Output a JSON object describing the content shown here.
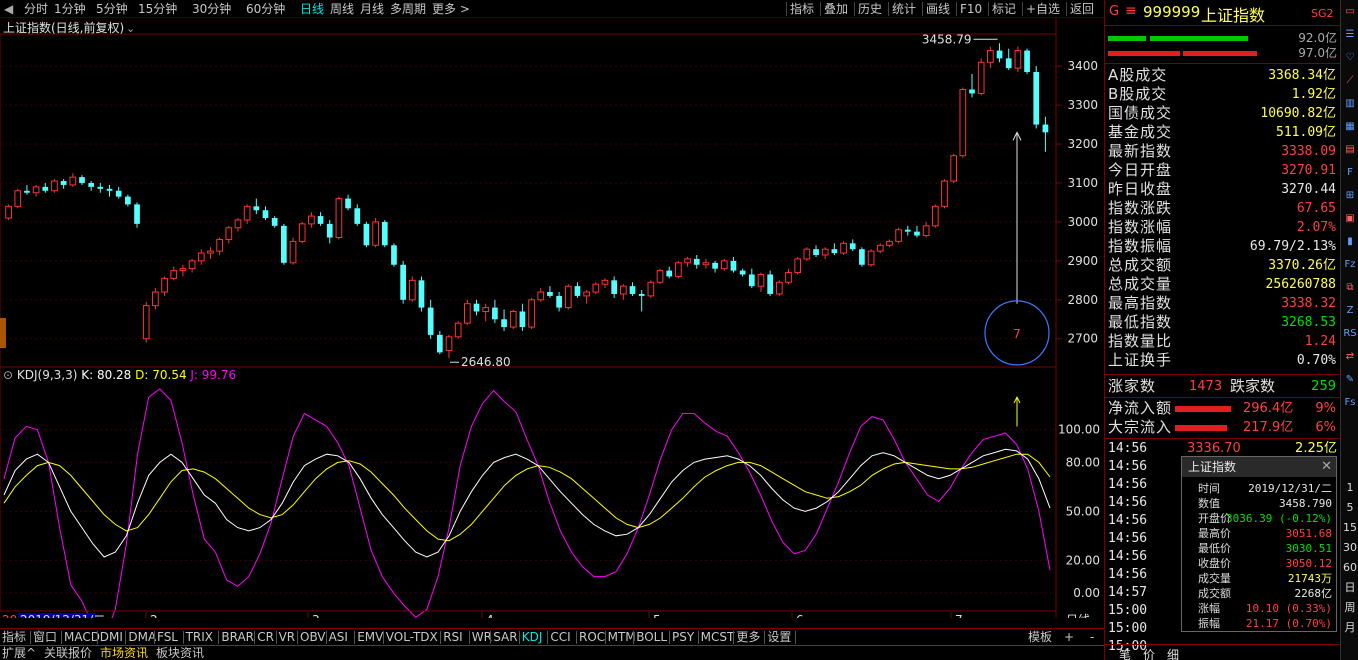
{
  "toolbar": {
    "periods": [
      "分时",
      "1分钟",
      "5分钟",
      "15分钟",
      "30分钟",
      "60分钟",
      "日线",
      "周线",
      "月线",
      "多周期",
      "更多"
    ],
    "active_period": "日线",
    "right_tools": [
      "指标",
      "叠加",
      "历史",
      "统计",
      "画线",
      "F10",
      "标记",
      "+自选",
      "返回"
    ]
  },
  "chart_title": "上证指数(日线,前复权)",
  "kdj_header": {
    "name": "KDJ(9,3,3)",
    "k": "K: 80.28",
    "d": "D: 70.54",
    "j": "J: 99.76"
  },
  "annotations": {
    "high_label": "3458.79",
    "low_label": "2646.80",
    "circle_label": "7"
  },
  "x_axis": {
    "first": "20",
    "cursor_date": "2019/12/31/二",
    "months": [
      "2",
      "3",
      "4",
      "5",
      "6",
      "7"
    ],
    "period_label": "日线"
  },
  "price_axis": [
    "3400",
    "3300",
    "3200",
    "3100",
    "3000",
    "2900",
    "2800",
    "2700"
  ],
  "kdj_axis": [
    "100.00",
    "80.00",
    "50.00",
    "20.00",
    "0.00"
  ],
  "indicators": [
    "指标",
    "窗口",
    "MACD",
    "DMI",
    "DMA",
    "FSL",
    "TRIX",
    "BRAR",
    "CR",
    "VR",
    "OBV",
    "ASI",
    "EMV",
    "VOL-TDX",
    "RSI",
    "WR",
    "SAR",
    "KDJ",
    "CCI",
    "ROC",
    "MTM",
    "BOLL",
    "PSY",
    "MCST",
    "更多",
    "设置"
  ],
  "active_indicator": "KDJ",
  "indicator_right": [
    "模板",
    "+",
    "-"
  ],
  "bottom_tabs": [
    "扩展^",
    "关联报价",
    "市场资讯",
    "板块资讯"
  ],
  "selected_tab": "市场资讯",
  "panel": {
    "g_letter": "G",
    "code": "999999",
    "name": "上证指数",
    "sg": "SG2",
    "bar1_value": "92.0亿",
    "bar2_value": "97.0亿",
    "rows": [
      {
        "k": "A股成交",
        "v": "3368.34亿",
        "c": "yel"
      },
      {
        "k": "B股成交",
        "v": "1.92亿",
        "c": "yel"
      },
      {
        "k": "国债成交",
        "v": "10690.82亿",
        "c": "yel"
      },
      {
        "k": "基金成交",
        "v": "511.09亿",
        "c": "yel"
      },
      {
        "k": "最新指数",
        "v": "3338.09",
        "c": "red"
      },
      {
        "k": "今日开盘",
        "v": "3270.91",
        "c": "red"
      },
      {
        "k": "昨日收盘",
        "v": "3270.44",
        "c": "wht"
      },
      {
        "k": "指数涨跌",
        "v": "67.65",
        "c": "red"
      },
      {
        "k": "指数涨幅",
        "v": "2.07%",
        "c": "red"
      },
      {
        "k": "指数振幅",
        "v": "69.79/2.13%",
        "c": "wht"
      },
      {
        "k": "总成交额",
        "v": "3370.26亿",
        "c": "yel"
      },
      {
        "k": "总成交量",
        "v": "256260788",
        "c": "yel"
      },
      {
        "k": "最高指数",
        "v": "3338.32",
        "c": "red"
      },
      {
        "k": "最低指数",
        "v": "3268.53",
        "c": "grn"
      },
      {
        "k": "指数量比",
        "v": "1.24",
        "c": "red"
      },
      {
        "k": "上证换手",
        "v": "0.70%",
        "c": "wht"
      }
    ],
    "up_label": "涨家数",
    "up_count": "1473",
    "down_label": "跌家数",
    "down_count": "259",
    "inflow_label": "净流入额",
    "inflow_value": "296.4亿",
    "inflow_pct": "9%",
    "block_label": "大宗流入",
    "block_value": "217.9亿",
    "block_pct": "6%",
    "tick_first": {
      "time": "14:56",
      "price": "3336.70",
      "vol": "2.25亿"
    },
    "ticks": [
      "14:56",
      "14:56",
      "14:56",
      "14:56",
      "14:56",
      "14:56",
      "14:56",
      "14:57",
      "15:00",
      "15:00",
      "15:00"
    ],
    "bottom": [
      "笔",
      "价",
      "细"
    ]
  },
  "popup": {
    "title": "上证指数",
    "close": "✕",
    "rows": [
      {
        "k": "时间",
        "v": "2019/12/31/二",
        "c": "wht"
      },
      {
        "k": "数值",
        "v": "3458.790",
        "c": "wht"
      },
      {
        "k": "开盘价",
        "v": "3036.39 (-0.12%)",
        "c": "grn"
      },
      {
        "k": "最高价",
        "v": "3051.68",
        "c": "red"
      },
      {
        "k": "最低价",
        "v": "3030.51",
        "c": "grn"
      },
      {
        "k": "收盘价",
        "v": "3050.12",
        "c": "red"
      },
      {
        "k": "成交量",
        "v": "21743万",
        "c": "yel"
      },
      {
        "k": "成交额",
        "v": "2268亿",
        "c": "wht"
      },
      {
        "k": "涨幅",
        "v": "10.10 (0.33%)",
        "c": "red"
      },
      {
        "k": "振幅",
        "v": "21.17 (0.70%)",
        "c": "red"
      }
    ]
  },
  "right_toolbar": [
    "1",
    "5",
    "15",
    "30",
    "60",
    "日",
    "周",
    "月"
  ],
  "colors": {
    "up": "#ff3232",
    "down": "#54ffff",
    "k_line": "#ffffff",
    "d_line": "#ffff00",
    "j_line": "#ff00ff",
    "grid": "#7a0000"
  },
  "chart_data": {
    "type": "candlestick",
    "title": "上证指数(日线,前复权)",
    "y_ticks": [
      2700,
      2800,
      2900,
      3000,
      3100,
      3200,
      3300,
      3400
    ],
    "high_mark": 3458.79,
    "low_mark": 2646.8,
    "ohlc": [
      [
        3010,
        3045,
        3005,
        3040
      ],
      [
        3040,
        3085,
        3035,
        3080
      ],
      [
        3080,
        3095,
        3070,
        3075
      ],
      [
        3075,
        3095,
        3065,
        3090
      ],
      [
        3090,
        3100,
        3075,
        3080
      ],
      [
        3080,
        3110,
        3075,
        3105
      ],
      [
        3105,
        3110,
        3085,
        3095
      ],
      [
        3095,
        3125,
        3090,
        3115
      ],
      [
        3115,
        3120,
        3095,
        3100
      ],
      [
        3100,
        3105,
        3080,
        3090
      ],
      [
        3090,
        3100,
        3075,
        3085
      ],
      [
        3085,
        3095,
        3065,
        3080
      ],
      [
        3080,
        3090,
        3060,
        3065
      ],
      [
        3065,
        3070,
        3040,
        3045
      ],
      [
        3045,
        3050,
        2985,
        2995
      ],
      [
        2700,
        2795,
        2690,
        2785
      ],
      [
        2785,
        2830,
        2775,
        2820
      ],
      [
        2820,
        2860,
        2810,
        2855
      ],
      [
        2855,
        2885,
        2850,
        2875
      ],
      [
        2875,
        2890,
        2860,
        2880
      ],
      [
        2880,
        2905,
        2870,
        2900
      ],
      [
        2900,
        2930,
        2890,
        2920
      ],
      [
        2920,
        2935,
        2905,
        2925
      ],
      [
        2925,
        2960,
        2915,
        2955
      ],
      [
        2955,
        2990,
        2945,
        2985
      ],
      [
        2985,
        3010,
        2975,
        3005
      ],
      [
        3005,
        3045,
        2995,
        3040
      ],
      [
        3040,
        3060,
        3020,
        3030
      ],
      [
        3030,
        3040,
        3005,
        3010
      ],
      [
        3010,
        3015,
        2985,
        2990
      ],
      [
        2990,
        2995,
        2890,
        2895
      ],
      [
        2895,
        2960,
        2890,
        2950
      ],
      [
        2950,
        3000,
        2945,
        2995
      ],
      [
        2995,
        3025,
        2985,
        3015
      ],
      [
        3015,
        3025,
        2990,
        2995
      ],
      [
        2995,
        3005,
        2945,
        2960
      ],
      [
        2960,
        3065,
        2955,
        3060
      ],
      [
        3060,
        3070,
        3030,
        3035
      ],
      [
        3035,
        3045,
        2990,
        2995
      ],
      [
        2995,
        3000,
        2935,
        2940
      ],
      [
        2940,
        3010,
        2935,
        3000
      ],
      [
        3000,
        3005,
        2935,
        2940
      ],
      [
        2940,
        2945,
        2885,
        2890
      ],
      [
        2890,
        2900,
        2790,
        2800
      ],
      [
        2800,
        2860,
        2795,
        2850
      ],
      [
        2850,
        2860,
        2770,
        2780
      ],
      [
        2780,
        2800,
        2700,
        2710
      ],
      [
        2710,
        2720,
        2660,
        2665
      ],
      [
        2670,
        2710,
        2650,
        2705
      ],
      [
        2705,
        2745,
        2700,
        2740
      ],
      [
        2740,
        2800,
        2735,
        2790
      ],
      [
        2790,
        2800,
        2760,
        2770
      ],
      [
        2770,
        2790,
        2745,
        2780
      ],
      [
        2780,
        2800,
        2740,
        2750
      ],
      [
        2750,
        2775,
        2720,
        2730
      ],
      [
        2730,
        2775,
        2725,
        2770
      ],
      [
        2770,
        2790,
        2720,
        2730
      ],
      [
        2730,
        2805,
        2725,
        2800
      ],
      [
        2800,
        2830,
        2795,
        2820
      ],
      [
        2820,
        2835,
        2805,
        2810
      ],
      [
        2810,
        2820,
        2770,
        2780
      ],
      [
        2780,
        2840,
        2775,
        2835
      ],
      [
        2835,
        2845,
        2805,
        2810
      ],
      [
        2810,
        2825,
        2790,
        2820
      ],
      [
        2820,
        2845,
        2815,
        2840
      ],
      [
        2840,
        2855,
        2830,
        2850
      ],
      [
        2850,
        2860,
        2805,
        2815
      ],
      [
        2815,
        2840,
        2800,
        2835
      ],
      [
        2835,
        2845,
        2810,
        2815
      ],
      [
        2815,
        2825,
        2770,
        2810
      ],
      [
        2810,
        2850,
        2805,
        2845
      ],
      [
        2845,
        2880,
        2840,
        2875
      ],
      [
        2875,
        2885,
        2855,
        2860
      ],
      [
        2860,
        2900,
        2855,
        2895
      ],
      [
        2895,
        2910,
        2885,
        2905
      ],
      [
        2905,
        2915,
        2880,
        2890
      ],
      [
        2890,
        2905,
        2880,
        2895
      ],
      [
        2895,
        2900,
        2870,
        2880
      ],
      [
        2880,
        2905,
        2875,
        2900
      ],
      [
        2900,
        2910,
        2870,
        2875
      ],
      [
        2875,
        2880,
        2860,
        2865
      ],
      [
        2865,
        2880,
        2830,
        2835
      ],
      [
        2835,
        2870,
        2820,
        2865
      ],
      [
        2865,
        2875,
        2810,
        2815
      ],
      [
        2815,
        2850,
        2810,
        2845
      ],
      [
        2845,
        2880,
        2840,
        2870
      ],
      [
        2870,
        2910,
        2865,
        2905
      ],
      [
        2905,
        2935,
        2900,
        2930
      ],
      [
        2930,
        2940,
        2910,
        2915
      ],
      [
        2915,
        2935,
        2905,
        2930
      ],
      [
        2930,
        2945,
        2915,
        2920
      ],
      [
        2920,
        2950,
        2915,
        2945
      ],
      [
        2945,
        2955,
        2925,
        2930
      ],
      [
        2930,
        2935,
        2885,
        2890
      ],
      [
        2890,
        2930,
        2885,
        2925
      ],
      [
        2925,
        2945,
        2920,
        2940
      ],
      [
        2940,
        2955,
        2935,
        2950
      ],
      [
        2950,
        2985,
        2945,
        2980
      ],
      [
        2980,
        2990,
        2965,
        2975
      ],
      [
        2975,
        2990,
        2960,
        2965
      ],
      [
        2965,
        3000,
        2960,
        2990
      ],
      [
        2990,
        3045,
        2985,
        3040
      ],
      [
        3040,
        3110,
        3035,
        3105
      ],
      [
        3105,
        3175,
        3100,
        3170
      ],
      [
        3170,
        3345,
        3165,
        3340
      ],
      [
        3340,
        3380,
        3320,
        3330
      ],
      [
        3330,
        3420,
        3325,
        3410
      ],
      [
        3410,
        3450,
        3395,
        3440
      ],
      [
        3440,
        3458.79,
        3410,
        3420
      ],
      [
        3420,
        3445,
        3390,
        3395
      ],
      [
        3395,
        3450,
        3385,
        3440
      ],
      [
        3440,
        3445,
        3380,
        3385
      ],
      [
        3385,
        3400,
        3240,
        3250
      ],
      [
        3250,
        3270,
        3180,
        3230
      ]
    ],
    "kdj": {
      "K": [
        60,
        75,
        82,
        85,
        80,
        65,
        50,
        40,
        30,
        22,
        25,
        35,
        55,
        72,
        80,
        85,
        80,
        70,
        60,
        55,
        45,
        40,
        38,
        40,
        45,
        55,
        68,
        78,
        82,
        85,
        84,
        80,
        70,
        58,
        48,
        40,
        32,
        25,
        22,
        25,
        35,
        50,
        62,
        72,
        80,
        83,
        85,
        82,
        78,
        70,
        62,
        55,
        48,
        42,
        38,
        35,
        36,
        40,
        48,
        58,
        68,
        75,
        80,
        82,
        83,
        84,
        82,
        78,
        72,
        64,
        57,
        52,
        50,
        52,
        56,
        62,
        70,
        78,
        84,
        86,
        84,
        80,
        76,
        72,
        70,
        72,
        76,
        80,
        84,
        86,
        88,
        87,
        82,
        70,
        52
      ],
      "D": [
        55,
        65,
        72,
        78,
        80,
        78,
        72,
        64,
        56,
        48,
        42,
        38,
        40,
        48,
        58,
        68,
        75,
        76,
        74,
        70,
        64,
        58,
        52,
        48,
        46,
        48,
        54,
        62,
        70,
        76,
        80,
        81,
        79,
        74,
        67,
        60,
        52,
        45,
        38,
        33,
        32,
        36,
        42,
        50,
        58,
        66,
        72,
        76,
        78,
        77,
        74,
        70,
        64,
        58,
        52,
        46,
        42,
        40,
        42,
        46,
        52,
        58,
        65,
        71,
        75,
        78,
        80,
        80,
        78,
        74,
        70,
        66,
        62,
        60,
        58,
        59,
        62,
        66,
        72,
        76,
        79,
        80,
        79,
        78,
        77,
        76,
        76,
        77,
        79,
        81,
        83,
        85,
        85,
        80,
        71
      ],
      "J": [
        70,
        95,
        102,
        100,
        80,
        40,
        5,
        -5,
        -20,
        -28,
        -10,
        30,
        85,
        120,
        125,
        118,
        92,
        60,
        33,
        25,
        8,
        4,
        10,
        24,
        43,
        70,
        96,
        110,
        106,
        102,
        92,
        78,
        52,
        26,
        10,
        0,
        -8,
        -15,
        -10,
        10,
        40,
        78,
        102,
        116,
        124,
        117,
        111,
        94,
        78,
        56,
        38,
        25,
        16,
        10,
        10,
        13,
        24,
        40,
        60,
        82,
        100,
        110,
        110,
        104,
        99,
        96,
        86,
        74,
        60,
        44,
        31,
        24,
        26,
        36,
        52,
        68,
        86,
        102,
        108,
        106,
        94,
        80,
        70,
        60,
        56,
        64,
        76,
        86,
        94,
        96,
        98,
        91,
        76,
        50,
        14
      ]
    }
  }
}
